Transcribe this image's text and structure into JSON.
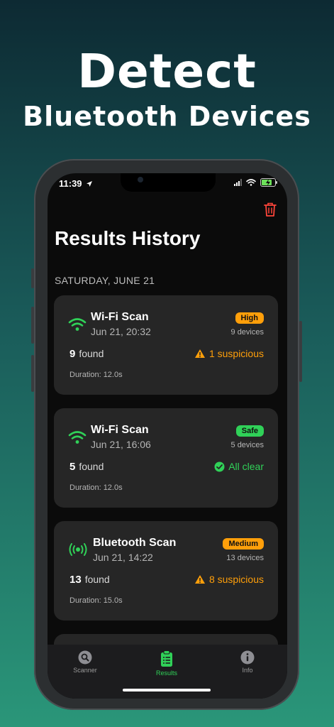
{
  "promo": {
    "headline": "Detect",
    "subhead": "Bluetooth Devices"
  },
  "status_bar": {
    "time": "11:39"
  },
  "page": {
    "title": "Results History",
    "section": "SATURDAY, JUNE 21"
  },
  "colors": {
    "accent": "#30d158",
    "warning": "#ff9f0a",
    "danger": "#ff453a",
    "high_badge": "#ff9f0a",
    "safe_badge": "#30d158",
    "medium_badge": "#ff9f0a"
  },
  "results": [
    {
      "icon": "wifi-icon",
      "name": "Wi-Fi Scan",
      "date": "Jun 21, 20:32",
      "badge": "High",
      "devices": "9 devices",
      "found_count": "9",
      "found_label": "found",
      "status": "1 suspicious",
      "status_icon": "warning-icon",
      "duration": "Duration: 12.0s"
    },
    {
      "icon": "wifi-icon",
      "name": "Wi-Fi Scan",
      "date": "Jun 21, 16:06",
      "badge": "Safe",
      "devices": "5 devices",
      "found_count": "5",
      "found_label": "found",
      "status": "All clear",
      "status_icon": "check-circle-icon",
      "duration": "Duration: 12.0s"
    },
    {
      "icon": "bluetooth-broadcast-icon",
      "name": "Bluetooth Scan",
      "date": "Jun 21, 14:22",
      "badge": "Medium",
      "devices": "13 devices",
      "found_count": "13",
      "found_label": "found",
      "status": "8 suspicious",
      "status_icon": "warning-icon",
      "duration": "Duration: 15.0s"
    }
  ],
  "tabbar": {
    "tabs": [
      {
        "label": "Scanner",
        "icon": "search-icon",
        "active": false
      },
      {
        "label": "Results",
        "icon": "clipboard-icon",
        "active": true
      },
      {
        "label": "Info",
        "icon": "info-icon",
        "active": false
      }
    ]
  }
}
